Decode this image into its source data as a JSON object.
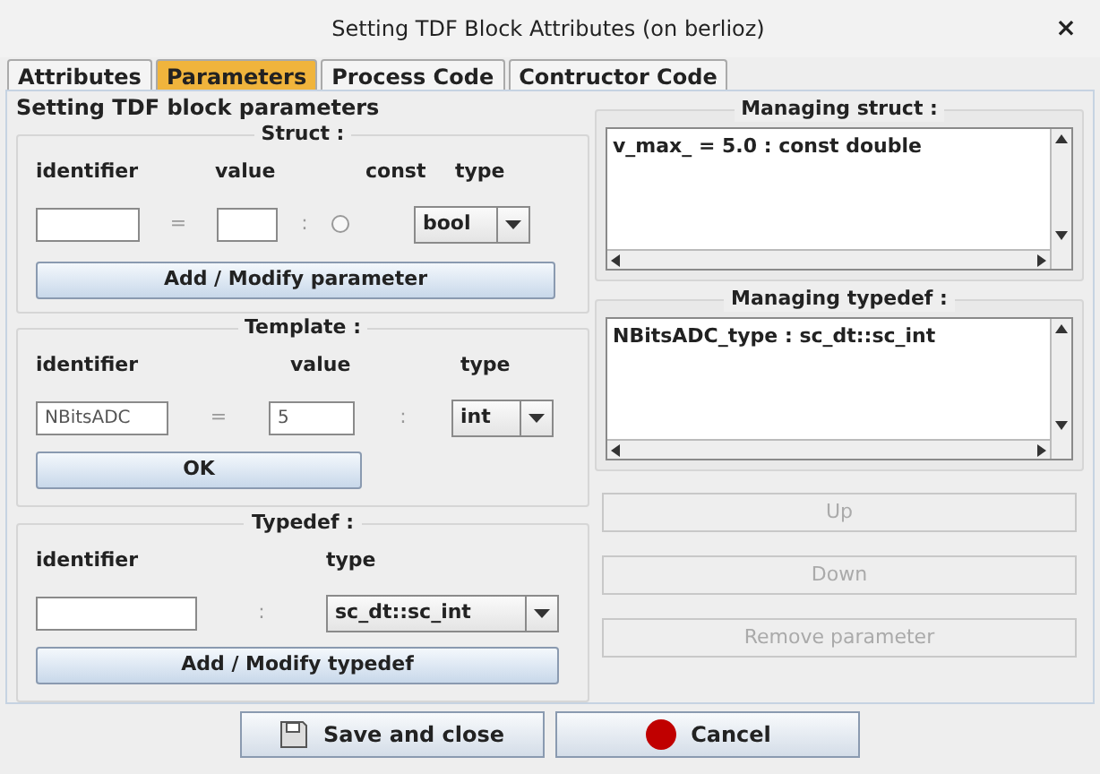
{
  "window": {
    "title": "Setting TDF Block Attributes (on berlioz)",
    "close": "×"
  },
  "tabs": [
    {
      "label": "Attributes",
      "selected": false
    },
    {
      "label": "Parameters",
      "selected": true
    },
    {
      "label": "Process Code",
      "selected": false
    },
    {
      "label": "Contructor Code",
      "selected": false
    }
  ],
  "panel_title": "Setting TDF block parameters",
  "struct": {
    "title": "Struct :",
    "labels": [
      "identifier",
      "value",
      "const",
      "type"
    ],
    "equals": "=",
    "colon": ":",
    "const_checked": false,
    "type": "bool",
    "button": "Add / Modify parameter"
  },
  "template": {
    "title": "Template :",
    "labels": [
      "identifier",
      "value",
      "type"
    ],
    "identifier": "NBitsADC",
    "equals": "=",
    "value": "5",
    "colon": ":",
    "type": "int",
    "button": "OK"
  },
  "typedef": {
    "title": "Typedef :",
    "labels": [
      "identifier",
      "type"
    ],
    "colon": ":",
    "type": "sc_dt::sc_int",
    "button": "Add / Modify typedef"
  },
  "managing_struct": {
    "title": "Managing struct :",
    "items": [
      "v_max_ = 5.0 : const double"
    ]
  },
  "managing_typedef": {
    "title": "Managing typedef :",
    "items": [
      "NBitsADC_type : sc_dt::sc_int"
    ]
  },
  "actions": [
    {
      "label": "Up",
      "disabled": true
    },
    {
      "label": "Down",
      "disabled": true
    },
    {
      "label": "Remove parameter",
      "disabled": true
    }
  ],
  "footer": [
    {
      "label": "Save and close",
      "kind": "save"
    },
    {
      "label": "Cancel",
      "kind": "cancel"
    }
  ]
}
